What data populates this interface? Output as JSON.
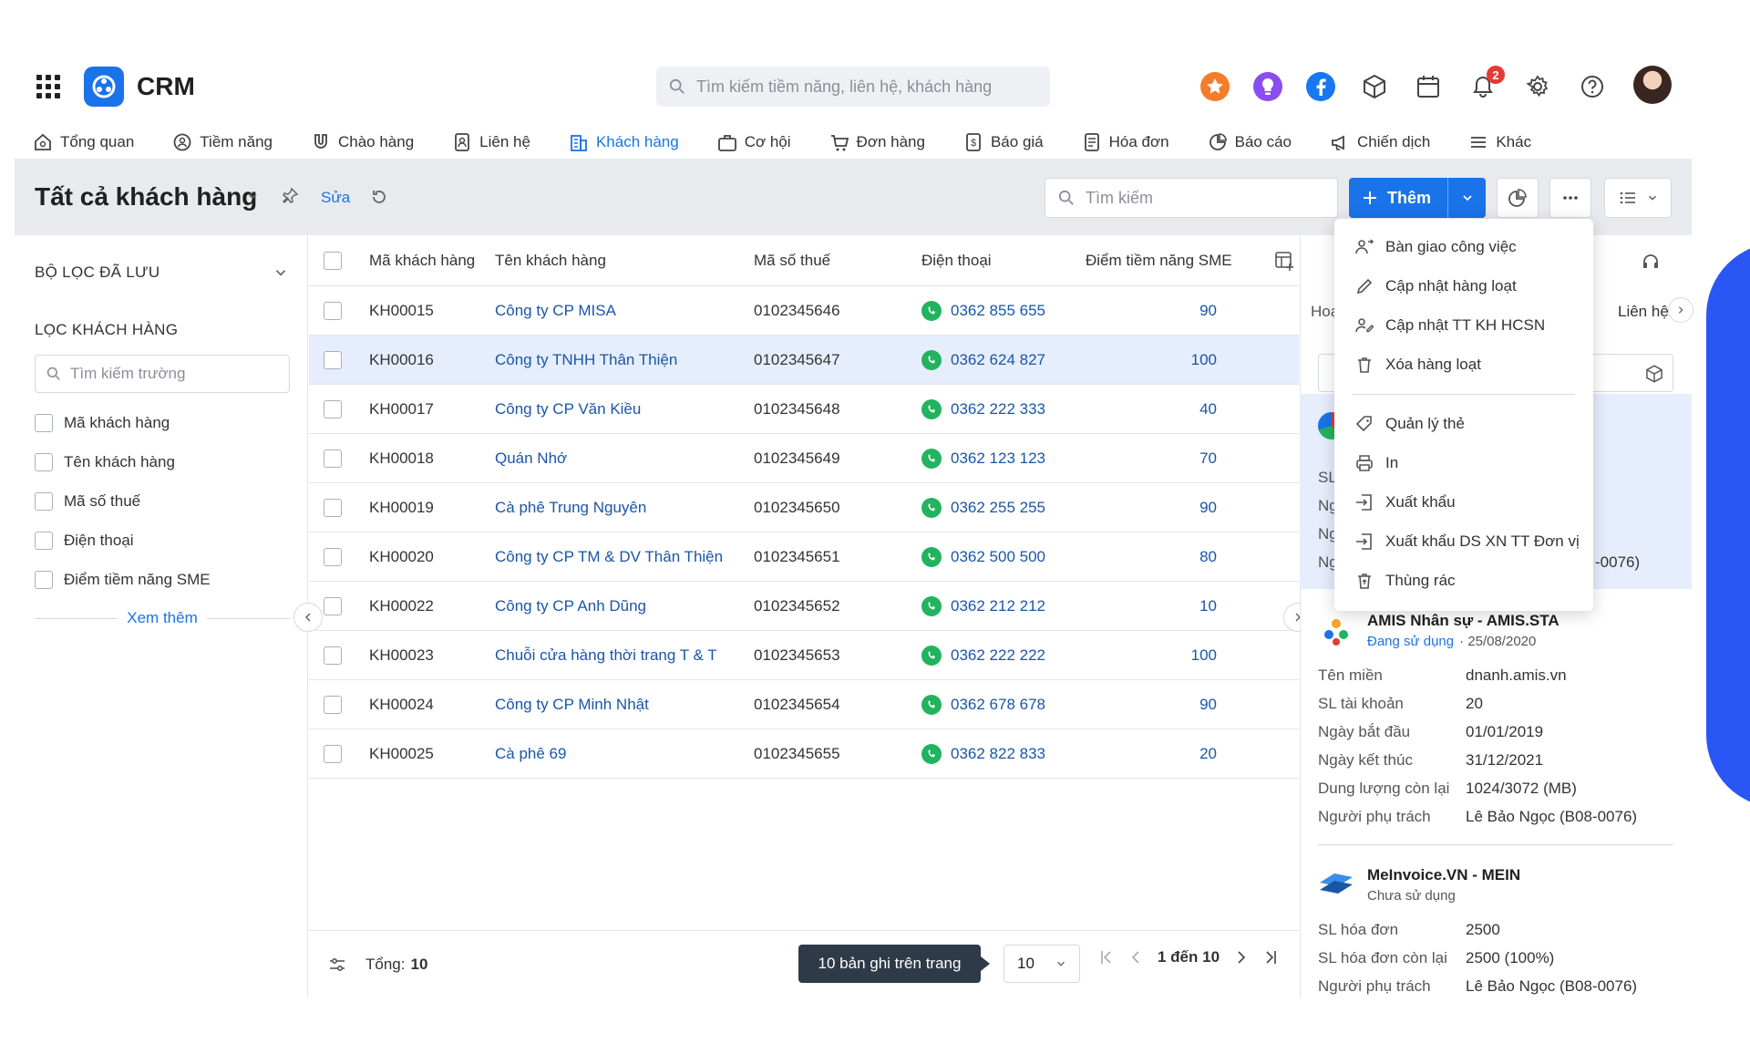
{
  "app": {
    "title": "CRM",
    "global_search_placeholder": "Tìm kiếm tiềm năng, liên hệ, khách hàng",
    "notification_count": "2"
  },
  "nav": {
    "items": [
      "Tổng quan",
      "Tiềm năng",
      "Chào hàng",
      "Liên hệ",
      "Khách hàng",
      "Cơ hội",
      "Đơn hàng",
      "Báo giá",
      "Hóa đơn",
      "Báo cáo",
      "Chiến dịch",
      "Khác"
    ],
    "active": "Khách hàng"
  },
  "page": {
    "title": "Tất cả khách hàng",
    "edit_label": "Sửa",
    "search_placeholder": "Tìm kiếm",
    "add_label": "Thêm"
  },
  "filters": {
    "saved_title": "BỘ LỌC ĐÃ LƯU",
    "customer_filter_title": "LỌC KHÁCH HÀNG",
    "field_search_placeholder": "Tìm kiếm trường",
    "fields": [
      "Mã khách hàng",
      "Tên khách hàng",
      "Mã số thuế",
      "Điện thoại",
      "Điểm tiềm năng SME"
    ],
    "see_more": "Xem thêm"
  },
  "table": {
    "headers": [
      "Mã khách hàng",
      "Tên khách hàng",
      "Mã số thuế",
      "Điện thoại",
      "Điểm tiềm năng SME"
    ],
    "rows": [
      {
        "code": "KH00015",
        "name": "Công ty CP MISA",
        "tax": "0102345646",
        "phone": "0362 855 655",
        "score": "90"
      },
      {
        "code": "KH00016",
        "name": "Công ty TNHH Thân Thiện",
        "tax": "0102345647",
        "phone": "0362 624 827",
        "score": "100"
      },
      {
        "code": "KH00017",
        "name": "Công ty CP Văn Kiều",
        "tax": "0102345648",
        "phone": "0362 222 333",
        "score": "40"
      },
      {
        "code": "KH00018",
        "name": "Quán Nhớ",
        "tax": "0102345649",
        "phone": "0362 123 123",
        "score": "70"
      },
      {
        "code": "KH00019",
        "name": "Cà phê Trung Nguyên",
        "tax": "0102345650",
        "phone": "0362 255 255",
        "score": "90"
      },
      {
        "code": "KH00020",
        "name": "Công ty CP TM & DV Thân Thiện",
        "tax": "0102345651",
        "phone": "0362 500 500",
        "score": "80"
      },
      {
        "code": "KH00022",
        "name": "Công ty CP Anh Dũng",
        "tax": "0102345652",
        "phone": "0362 212 212",
        "score": "10"
      },
      {
        "code": "KH00023",
        "name": "Chuỗi cửa hàng thời trang T & T",
        "tax": "0102345653",
        "phone": "0362 222 222",
        "score": "100"
      },
      {
        "code": "KH00024",
        "name": "Công ty CP Minh Nhật",
        "tax": "0102345654",
        "phone": "0362 678 678",
        "score": "90"
      },
      {
        "code": "KH00025",
        "name": "Cà phê 69",
        "tax": "0102345655",
        "phone": "0362 822 833",
        "score": "20"
      }
    ],
    "selected_index": 1
  },
  "footer": {
    "total_label": "Tổng:",
    "total_value": "10",
    "tooltip": "10 bản ghi trên trang",
    "page_size": "10",
    "range_label": "1 đến 10"
  },
  "menu": {
    "items": [
      "Bàn giao công việc",
      "Cập nhật hàng loạt",
      "Cập nhật TT KH HCSN",
      "Xóa hàng loạt",
      "Quản lý thẻ",
      "In",
      "Xuất khẩu",
      "Xuất khẩu DS XN TT Đơn vị",
      "Thùng rác"
    ]
  },
  "right_panel": {
    "tab_left_partial": "Hoạ",
    "tab_right": "Liên hệ",
    "partial_labels": [
      "SL",
      "Ng",
      "Ng",
      "Ng"
    ],
    "partial_value": "-0076)",
    "products": [
      {
        "name": "AMIS Nhân sự - AMIS.STA",
        "status": "Đang sử dụng",
        "date": "· 25/08/2020",
        "fields": [
          {
            "k": "Tên miền",
            "v": "dnanh.amis.vn"
          },
          {
            "k": "SL tài khoản",
            "v": "20"
          },
          {
            "k": "Ngày bắt đầu",
            "v": "01/01/2019"
          },
          {
            "k": "Ngày kết thúc",
            "v": "31/12/2021"
          },
          {
            "k": "Dung lượng còn lại",
            "v": "1024/3072 (MB)"
          },
          {
            "k": "Người phụ trách",
            "v": "Lê Bảo Ngọc (B08-0076)"
          }
        ]
      },
      {
        "name": "MeInvoice.VN - MEIN",
        "status": "Chưa sử dụng",
        "fields": [
          {
            "k": "SL hóa đơn",
            "v": "2500"
          },
          {
            "k": "SL hóa đơn còn lại",
            "v": "2500 (100%)"
          },
          {
            "k": "Người phụ trách",
            "v": "Lê Bảo Ngọc (B08-0076)"
          }
        ]
      }
    ]
  },
  "colors": {
    "accent": "#1a73e8",
    "link": "#1a56a8",
    "selected_row": "#e6edfc",
    "phone_green": "#22b35e",
    "side_edge": "#2a56f5"
  }
}
